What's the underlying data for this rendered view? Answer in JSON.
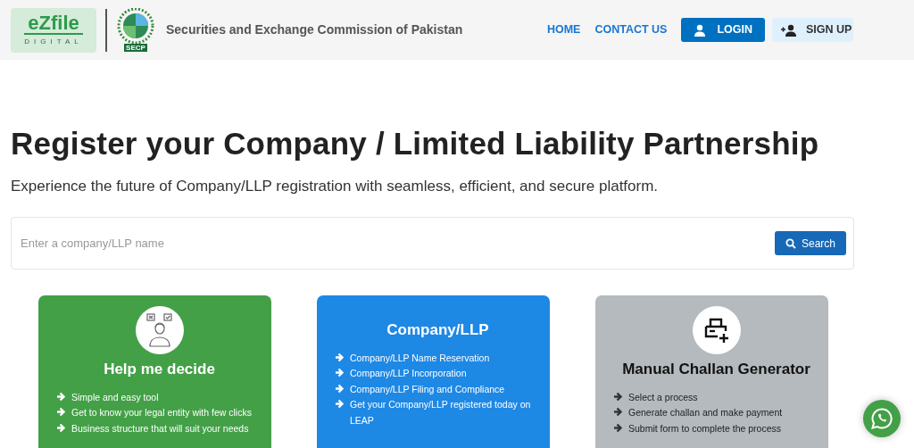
{
  "header": {
    "logo": {
      "wordmark": "eZfile",
      "tagline": "DIGITAL"
    },
    "emblem_label": "SECP",
    "organization": "Securities and Exchange Commission of Pakistan",
    "nav": [
      {
        "label": "HOME",
        "kind": "link"
      },
      {
        "label": "CONTACT US",
        "kind": "link"
      },
      {
        "label": "LOGIN",
        "kind": "primary"
      },
      {
        "label": "SIGN UP",
        "kind": "light"
      }
    ]
  },
  "hero": {
    "title": "Register your Company / Limited Liability Partnership",
    "subtitle": "Experience the future of Company/LLP registration with seamless, efficient, and secure platform."
  },
  "search": {
    "placeholder": "Enter a company/LLP name",
    "button": "Search"
  },
  "cards": [
    {
      "kind": "decide",
      "title": "Help me decide",
      "color": "#43a047",
      "items": [
        "Simple and easy tool",
        "Get to know your legal entity with few clicks",
        "Business structure that will suit your needs"
      ]
    },
    {
      "kind": "plain",
      "title": "Company/LLP",
      "color": "#1e88e5",
      "items": [
        "Company/LLP Name Reservation",
        "Company/LLP Incorporation",
        "Company/LLP Filing and Compliance",
        "Get your Company/LLP registered today on LEAP"
      ]
    },
    {
      "kind": "challan",
      "title": "Manual Challan Generator",
      "color": "#b4babe",
      "items": [
        "Select a process",
        "Generate challan and make payment",
        "Submit form to complete the process"
      ]
    }
  ]
}
